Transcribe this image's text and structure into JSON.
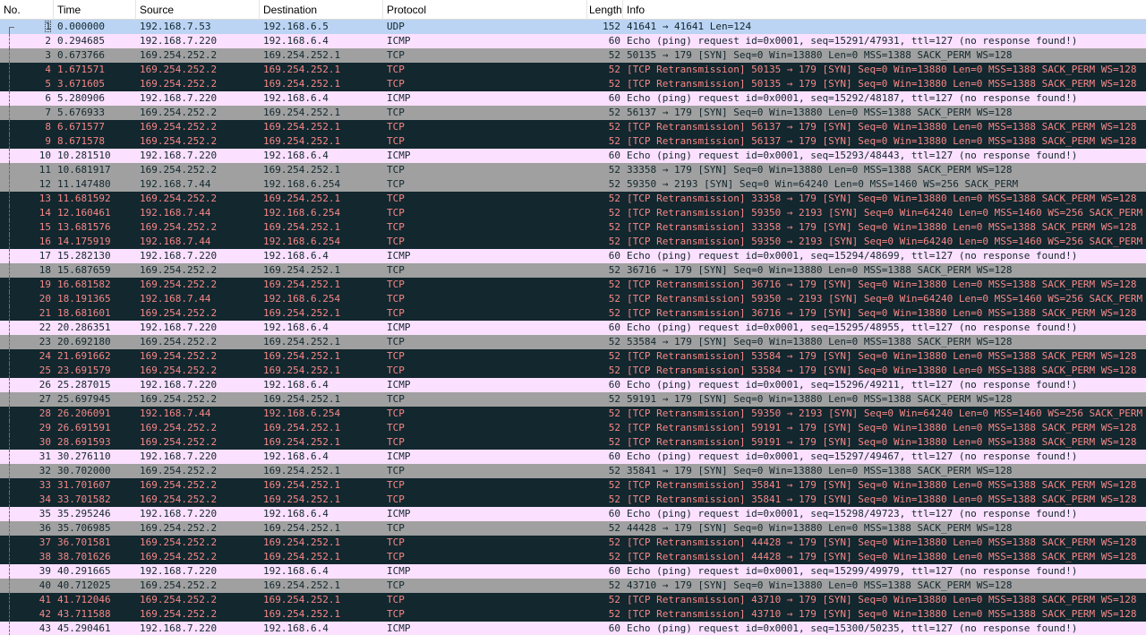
{
  "columns": {
    "no": "No.",
    "time": "Time",
    "source": "Source",
    "destination": "Destination",
    "protocol": "Protocol",
    "length": "Length",
    "info": "Info"
  },
  "colors": {
    "udp": "#dae8fc",
    "icmp": "#fce0ff",
    "tcp": "#a0a0a0",
    "bad_bg": "#12272e",
    "bad_fg": "#f78787"
  },
  "packets": [
    {
      "no": "1",
      "time": "0.000000",
      "src": "192.168.7.53",
      "dst": "192.168.6.5",
      "proto": "UDP",
      "len": "152",
      "info": "41641 → 41641 Len=124",
      "style": "udp selected"
    },
    {
      "no": "2",
      "time": "0.294685",
      "src": "192.168.7.220",
      "dst": "192.168.6.4",
      "proto": "ICMP",
      "len": "60",
      "info": "Echo (ping) request  id=0x0001, seq=15291/47931, ttl=127 (no response found!)",
      "style": "icmp"
    },
    {
      "no": "3",
      "time": "0.673766",
      "src": "169.254.252.2",
      "dst": "169.254.252.1",
      "proto": "TCP",
      "len": "52",
      "info": "50135 → 179 [SYN] Seq=0 Win=13880 Len=0 MSS=1388 SACK_PERM WS=128",
      "style": "tcp"
    },
    {
      "no": "4",
      "time": "1.671571",
      "src": "169.254.252.2",
      "dst": "169.254.252.1",
      "proto": "TCP",
      "len": "52",
      "info": "[TCP Retransmission] 50135 → 179 [SYN] Seq=0 Win=13880 Len=0 MSS=1388 SACK_PERM WS=128",
      "style": "bad"
    },
    {
      "no": "5",
      "time": "3.671605",
      "src": "169.254.252.2",
      "dst": "169.254.252.1",
      "proto": "TCP",
      "len": "52",
      "info": "[TCP Retransmission] 50135 → 179 [SYN] Seq=0 Win=13880 Len=0 MSS=1388 SACK_PERM WS=128",
      "style": "bad"
    },
    {
      "no": "6",
      "time": "5.280906",
      "src": "192.168.7.220",
      "dst": "192.168.6.4",
      "proto": "ICMP",
      "len": "60",
      "info": "Echo (ping) request  id=0x0001, seq=15292/48187, ttl=127 (no response found!)",
      "style": "icmp"
    },
    {
      "no": "7",
      "time": "5.676933",
      "src": "169.254.252.2",
      "dst": "169.254.252.1",
      "proto": "TCP",
      "len": "52",
      "info": "56137 → 179 [SYN] Seq=0 Win=13880 Len=0 MSS=1388 SACK_PERM WS=128",
      "style": "tcp"
    },
    {
      "no": "8",
      "time": "6.671577",
      "src": "169.254.252.2",
      "dst": "169.254.252.1",
      "proto": "TCP",
      "len": "52",
      "info": "[TCP Retransmission] 56137 → 179 [SYN] Seq=0 Win=13880 Len=0 MSS=1388 SACK_PERM WS=128",
      "style": "bad"
    },
    {
      "no": "9",
      "time": "8.671578",
      "src": "169.254.252.2",
      "dst": "169.254.252.1",
      "proto": "TCP",
      "len": "52",
      "info": "[TCP Retransmission] 56137 → 179 [SYN] Seq=0 Win=13880 Len=0 MSS=1388 SACK_PERM WS=128",
      "style": "bad"
    },
    {
      "no": "10",
      "time": "10.281510",
      "src": "192.168.7.220",
      "dst": "192.168.6.4",
      "proto": "ICMP",
      "len": "60",
      "info": "Echo (ping) request  id=0x0001, seq=15293/48443, ttl=127 (no response found!)",
      "style": "icmp"
    },
    {
      "no": "11",
      "time": "10.681917",
      "src": "169.254.252.2",
      "dst": "169.254.252.1",
      "proto": "TCP",
      "len": "52",
      "info": "33358 → 179 [SYN] Seq=0 Win=13880 Len=0 MSS=1388 SACK_PERM WS=128",
      "style": "tcp"
    },
    {
      "no": "12",
      "time": "11.147480",
      "src": "192.168.7.44",
      "dst": "192.168.6.254",
      "proto": "TCP",
      "len": "52",
      "info": "59350 → 2193 [SYN] Seq=0 Win=64240 Len=0 MSS=1460 WS=256 SACK_PERM",
      "style": "tcp"
    },
    {
      "no": "13",
      "time": "11.681592",
      "src": "169.254.252.2",
      "dst": "169.254.252.1",
      "proto": "TCP",
      "len": "52",
      "info": "[TCP Retransmission] 33358 → 179 [SYN] Seq=0 Win=13880 Len=0 MSS=1388 SACK_PERM WS=128",
      "style": "bad"
    },
    {
      "no": "14",
      "time": "12.160461",
      "src": "192.168.7.44",
      "dst": "192.168.6.254",
      "proto": "TCP",
      "len": "52",
      "info": "[TCP Retransmission] 59350 → 2193 [SYN] Seq=0 Win=64240 Len=0 MSS=1460 WS=256 SACK_PERM",
      "style": "bad"
    },
    {
      "no": "15",
      "time": "13.681576",
      "src": "169.254.252.2",
      "dst": "169.254.252.1",
      "proto": "TCP",
      "len": "52",
      "info": "[TCP Retransmission] 33358 → 179 [SYN] Seq=0 Win=13880 Len=0 MSS=1388 SACK_PERM WS=128",
      "style": "bad"
    },
    {
      "no": "16",
      "time": "14.175919",
      "src": "192.168.7.44",
      "dst": "192.168.6.254",
      "proto": "TCP",
      "len": "52",
      "info": "[TCP Retransmission] 59350 → 2193 [SYN] Seq=0 Win=64240 Len=0 MSS=1460 WS=256 SACK_PERM",
      "style": "bad"
    },
    {
      "no": "17",
      "time": "15.282130",
      "src": "192.168.7.220",
      "dst": "192.168.6.4",
      "proto": "ICMP",
      "len": "60",
      "info": "Echo (ping) request  id=0x0001, seq=15294/48699, ttl=127 (no response found!)",
      "style": "icmp"
    },
    {
      "no": "18",
      "time": "15.687659",
      "src": "169.254.252.2",
      "dst": "169.254.252.1",
      "proto": "TCP",
      "len": "52",
      "info": "36716 → 179 [SYN] Seq=0 Win=13880 Len=0 MSS=1388 SACK_PERM WS=128",
      "style": "tcp"
    },
    {
      "no": "19",
      "time": "16.681582",
      "src": "169.254.252.2",
      "dst": "169.254.252.1",
      "proto": "TCP",
      "len": "52",
      "info": "[TCP Retransmission] 36716 → 179 [SYN] Seq=0 Win=13880 Len=0 MSS=1388 SACK_PERM WS=128",
      "style": "bad"
    },
    {
      "no": "20",
      "time": "18.191365",
      "src": "192.168.7.44",
      "dst": "192.168.6.254",
      "proto": "TCP",
      "len": "52",
      "info": "[TCP Retransmission] 59350 → 2193 [SYN] Seq=0 Win=64240 Len=0 MSS=1460 WS=256 SACK_PERM",
      "style": "bad"
    },
    {
      "no": "21",
      "time": "18.681601",
      "src": "169.254.252.2",
      "dst": "169.254.252.1",
      "proto": "TCP",
      "len": "52",
      "info": "[TCP Retransmission] 36716 → 179 [SYN] Seq=0 Win=13880 Len=0 MSS=1388 SACK_PERM WS=128",
      "style": "bad"
    },
    {
      "no": "22",
      "time": "20.286351",
      "src": "192.168.7.220",
      "dst": "192.168.6.4",
      "proto": "ICMP",
      "len": "60",
      "info": "Echo (ping) request  id=0x0001, seq=15295/48955, ttl=127 (no response found!)",
      "style": "icmp"
    },
    {
      "no": "23",
      "time": "20.692180",
      "src": "169.254.252.2",
      "dst": "169.254.252.1",
      "proto": "TCP",
      "len": "52",
      "info": "53584 → 179 [SYN] Seq=0 Win=13880 Len=0 MSS=1388 SACK_PERM WS=128",
      "style": "tcp"
    },
    {
      "no": "24",
      "time": "21.691662",
      "src": "169.254.252.2",
      "dst": "169.254.252.1",
      "proto": "TCP",
      "len": "52",
      "info": "[TCP Retransmission] 53584 → 179 [SYN] Seq=0 Win=13880 Len=0 MSS=1388 SACK_PERM WS=128",
      "style": "bad"
    },
    {
      "no": "25",
      "time": "23.691579",
      "src": "169.254.252.2",
      "dst": "169.254.252.1",
      "proto": "TCP",
      "len": "52",
      "info": "[TCP Retransmission] 53584 → 179 [SYN] Seq=0 Win=13880 Len=0 MSS=1388 SACK_PERM WS=128",
      "style": "bad"
    },
    {
      "no": "26",
      "time": "25.287015",
      "src": "192.168.7.220",
      "dst": "192.168.6.4",
      "proto": "ICMP",
      "len": "60",
      "info": "Echo (ping) request  id=0x0001, seq=15296/49211, ttl=127 (no response found!)",
      "style": "icmp"
    },
    {
      "no": "27",
      "time": "25.697945",
      "src": "169.254.252.2",
      "dst": "169.254.252.1",
      "proto": "TCP",
      "len": "52",
      "info": "59191 → 179 [SYN] Seq=0 Win=13880 Len=0 MSS=1388 SACK_PERM WS=128",
      "style": "tcp"
    },
    {
      "no": "28",
      "time": "26.206091",
      "src": "192.168.7.44",
      "dst": "192.168.6.254",
      "proto": "TCP",
      "len": "52",
      "info": "[TCP Retransmission] 59350 → 2193 [SYN] Seq=0 Win=64240 Len=0 MSS=1460 WS=256 SACK_PERM",
      "style": "bad"
    },
    {
      "no": "29",
      "time": "26.691591",
      "src": "169.254.252.2",
      "dst": "169.254.252.1",
      "proto": "TCP",
      "len": "52",
      "info": "[TCP Retransmission] 59191 → 179 [SYN] Seq=0 Win=13880 Len=0 MSS=1388 SACK_PERM WS=128",
      "style": "bad"
    },
    {
      "no": "30",
      "time": "28.691593",
      "src": "169.254.252.2",
      "dst": "169.254.252.1",
      "proto": "TCP",
      "len": "52",
      "info": "[TCP Retransmission] 59191 → 179 [SYN] Seq=0 Win=13880 Len=0 MSS=1388 SACK_PERM WS=128",
      "style": "bad"
    },
    {
      "no": "31",
      "time": "30.276110",
      "src": "192.168.7.220",
      "dst": "192.168.6.4",
      "proto": "ICMP",
      "len": "60",
      "info": "Echo (ping) request  id=0x0001, seq=15297/49467, ttl=127 (no response found!)",
      "style": "icmp"
    },
    {
      "no": "32",
      "time": "30.702000",
      "src": "169.254.252.2",
      "dst": "169.254.252.1",
      "proto": "TCP",
      "len": "52",
      "info": "35841 → 179 [SYN] Seq=0 Win=13880 Len=0 MSS=1388 SACK_PERM WS=128",
      "style": "tcp"
    },
    {
      "no": "33",
      "time": "31.701607",
      "src": "169.254.252.2",
      "dst": "169.254.252.1",
      "proto": "TCP",
      "len": "52",
      "info": "[TCP Retransmission] 35841 → 179 [SYN] Seq=0 Win=13880 Len=0 MSS=1388 SACK_PERM WS=128",
      "style": "bad"
    },
    {
      "no": "34",
      "time": "33.701582",
      "src": "169.254.252.2",
      "dst": "169.254.252.1",
      "proto": "TCP",
      "len": "52",
      "info": "[TCP Retransmission] 35841 → 179 [SYN] Seq=0 Win=13880 Len=0 MSS=1388 SACK_PERM WS=128",
      "style": "bad"
    },
    {
      "no": "35",
      "time": "35.295246",
      "src": "192.168.7.220",
      "dst": "192.168.6.4",
      "proto": "ICMP",
      "len": "60",
      "info": "Echo (ping) request  id=0x0001, seq=15298/49723, ttl=127 (no response found!)",
      "style": "icmp"
    },
    {
      "no": "36",
      "time": "35.706985",
      "src": "169.254.252.2",
      "dst": "169.254.252.1",
      "proto": "TCP",
      "len": "52",
      "info": "44428 → 179 [SYN] Seq=0 Win=13880 Len=0 MSS=1388 SACK_PERM WS=128",
      "style": "tcp"
    },
    {
      "no": "37",
      "time": "36.701581",
      "src": "169.254.252.2",
      "dst": "169.254.252.1",
      "proto": "TCP",
      "len": "52",
      "info": "[TCP Retransmission] 44428 → 179 [SYN] Seq=0 Win=13880 Len=0 MSS=1388 SACK_PERM WS=128",
      "style": "bad"
    },
    {
      "no": "38",
      "time": "38.701626",
      "src": "169.254.252.2",
      "dst": "169.254.252.1",
      "proto": "TCP",
      "len": "52",
      "info": "[TCP Retransmission] 44428 → 179 [SYN] Seq=0 Win=13880 Len=0 MSS=1388 SACK_PERM WS=128",
      "style": "bad"
    },
    {
      "no": "39",
      "time": "40.291665",
      "src": "192.168.7.220",
      "dst": "192.168.6.4",
      "proto": "ICMP",
      "len": "60",
      "info": "Echo (ping) request  id=0x0001, seq=15299/49979, ttl=127 (no response found!)",
      "style": "icmp"
    },
    {
      "no": "40",
      "time": "40.712025",
      "src": "169.254.252.2",
      "dst": "169.254.252.1",
      "proto": "TCP",
      "len": "52",
      "info": "43710 → 179 [SYN] Seq=0 Win=13880 Len=0 MSS=1388 SACK_PERM WS=128",
      "style": "tcp"
    },
    {
      "no": "41",
      "time": "41.712046",
      "src": "169.254.252.2",
      "dst": "169.254.252.1",
      "proto": "TCP",
      "len": "52",
      "info": "[TCP Retransmission] 43710 → 179 [SYN] Seq=0 Win=13880 Len=0 MSS=1388 SACK_PERM WS=128",
      "style": "bad"
    },
    {
      "no": "42",
      "time": "43.711588",
      "src": "169.254.252.2",
      "dst": "169.254.252.1",
      "proto": "TCP",
      "len": "52",
      "info": "[TCP Retransmission] 43710 → 179 [SYN] Seq=0 Win=13880 Len=0 MSS=1388 SACK_PERM WS=128",
      "style": "bad"
    },
    {
      "no": "43",
      "time": "45.290461",
      "src": "192.168.7.220",
      "dst": "192.168.6.4",
      "proto": "ICMP",
      "len": "60",
      "info": "Echo (ping) request  id=0x0001, seq=15300/50235, ttl=127 (no response found!)",
      "style": "icmp"
    }
  ]
}
